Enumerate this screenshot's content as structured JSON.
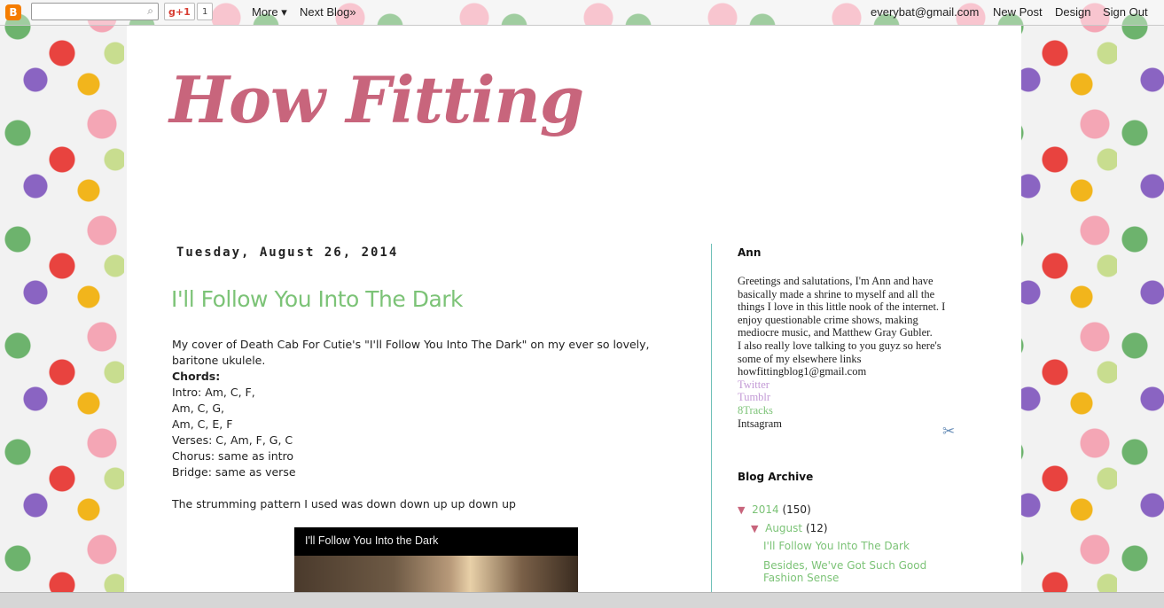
{
  "navbar": {
    "search_placeholder": "",
    "gplus_label": "g+1",
    "gplus_count": "1",
    "more_label": "More ▾",
    "next_blog_label": "Next Blog»",
    "user_email": "everybat@gmail.com",
    "new_post_label": "New Post",
    "design_label": "Design",
    "sign_out_label": "Sign Out"
  },
  "blog": {
    "title": "How Fitting"
  },
  "post": {
    "date": "Tuesday, August 26, 2014",
    "title": "I'll Follow You Into The Dark",
    "intro": "My cover of Death Cab For Cutie's \"I'll Follow You Into The Dark\" on my ever so lovely, baritone ukulele.",
    "chords_heading": "Chords:",
    "chord_lines": [
      "Intro: Am, C, F,",
      "Am, C, G,",
      "Am, C, E, F",
      "Verses: C, Am, F, G, C",
      "Chorus: same as intro",
      "Bridge: same as verse"
    ],
    "strumming": "The strumming pattern I used was down down up up down up",
    "video_title": "I'll Follow You Into the Dark"
  },
  "sidebar": {
    "about": {
      "heading": "Ann",
      "text_lines": [
        "Greetings and salutations, I'm Ann and have",
        "basically made a shrine to myself and all the",
        "things I love in this little nook of the internet. I",
        "enjoy questionable crime shows, making",
        "mediocre music, and Matthew Gray Gubler.",
        "I also really love talking to you guyz so here's",
        "some of my elsewhere links",
        "howfittingblog1@gmail.com"
      ],
      "links": [
        "Twitter",
        "Tumblr",
        "8Tracks"
      ],
      "instagram": "Intsagram"
    },
    "archive": {
      "heading": "Blog Archive",
      "year": "2014",
      "year_count": "(150)",
      "month": "August",
      "month_count": "(12)",
      "posts": [
        "I'll Follow You Into The Dark",
        "Besides, We've Got Such Good Fashion Sense"
      ]
    }
  }
}
